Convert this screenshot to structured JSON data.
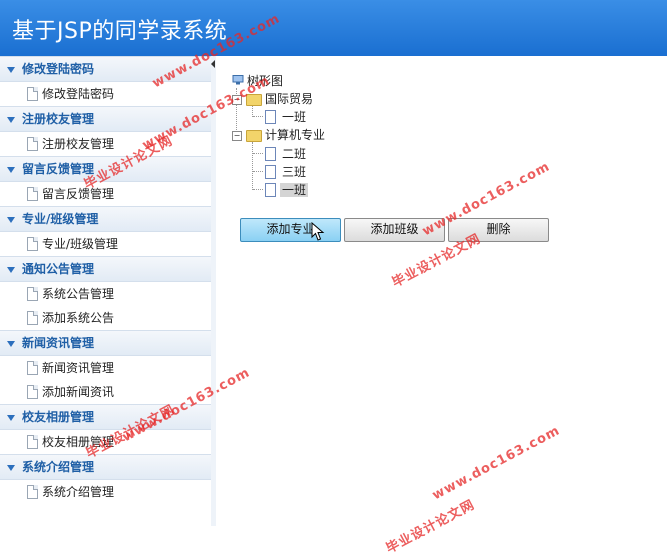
{
  "header": {
    "title": "基于JSP的同学录系统"
  },
  "sidebar": {
    "sections": [
      {
        "title": "修改登陆密码",
        "items": [
          "修改登陆密码"
        ]
      },
      {
        "title": "注册校友管理",
        "items": [
          "注册校友管理"
        ]
      },
      {
        "title": "留言反馈管理",
        "items": [
          "留言反馈管理"
        ]
      },
      {
        "title": "专业/班级管理",
        "items": [
          "专业/班级管理"
        ]
      },
      {
        "title": "通知公告管理",
        "items": [
          "系统公告管理",
          "添加系统公告"
        ]
      },
      {
        "title": "新闻资讯管理",
        "items": [
          "新闻资讯管理",
          "添加新闻资讯"
        ]
      },
      {
        "title": "校友相册管理",
        "items": [
          "校友相册管理"
        ]
      },
      {
        "title": "系统介绍管理",
        "items": [
          "系统介绍管理"
        ]
      }
    ]
  },
  "tree": {
    "root": "树形图",
    "nodes": [
      {
        "label": "国际贸易",
        "children": [
          "一班"
        ]
      },
      {
        "label": "计算机专业",
        "children": [
          "二班",
          "三班",
          "一班"
        ]
      }
    ],
    "selected": "一班"
  },
  "buttons": {
    "add_major": "添加专业",
    "add_class": "添加班级",
    "delete": "删除"
  },
  "watermarks": {
    "site": "www.doc163.com",
    "brand": "毕业设计论文网"
  },
  "colors": {
    "header": "#1a6fd1",
    "section_text": "#1f5fa6",
    "watermark": "#e62828",
    "active_button": "#8ad0f3"
  }
}
